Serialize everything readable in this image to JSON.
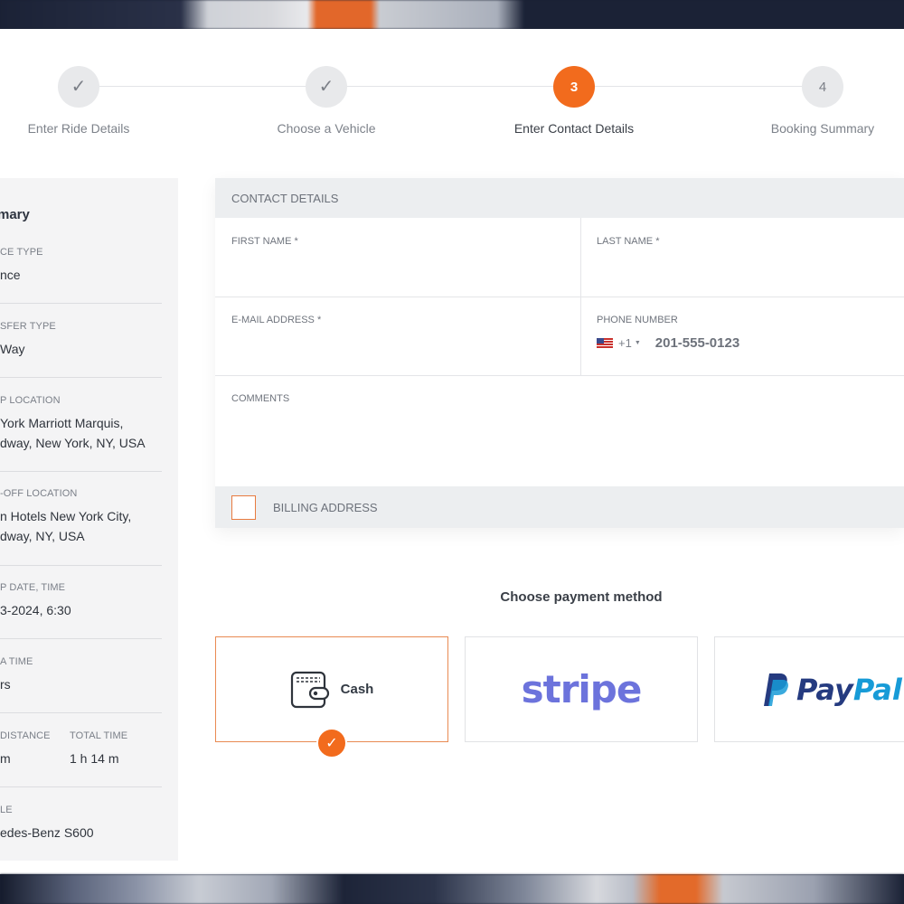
{
  "stepper": {
    "steps": [
      {
        "label": "Enter Ride Details",
        "marker": "✓",
        "state": "done"
      },
      {
        "label": "Choose a Vehicle",
        "marker": "✓",
        "state": "done"
      },
      {
        "label": "Enter Contact Details",
        "marker": "3",
        "state": "active"
      },
      {
        "label": "Booking Summary",
        "marker": "4",
        "state": "pending"
      }
    ]
  },
  "summary": {
    "title": "mary",
    "items": [
      {
        "label": "CE TYPE",
        "value": "nce"
      },
      {
        "label": "SFER TYPE",
        "value": "Way"
      },
      {
        "label": "P LOCATION",
        "value_line1": "York Marriott Marquis,",
        "value_line2": "dway, New York, NY, USA"
      },
      {
        "label": "-OFF LOCATION",
        "value_line1": "n Hotels New York City,",
        "value_line2": "dway, NY, USA"
      },
      {
        "label": "P DATE, TIME",
        "value": "3-2024, 6:30"
      },
      {
        "label": "A TIME",
        "value": "rs"
      },
      {
        "label_a": "DISTANCE",
        "value_a": "m",
        "label_b": "TOTAL TIME",
        "value_b": "1 h 14 m"
      },
      {
        "label": "LE",
        "value": "edes-Benz S600"
      }
    ]
  },
  "contact": {
    "header": "CONTACT DETAILS",
    "first_name_label": "FIRST NAME",
    "last_name_label": "LAST NAME",
    "email_label": "E-MAIL ADDRESS",
    "phone_label": "PHONE NUMBER",
    "required_mark": "*",
    "phone_dial_code": "+1",
    "phone_placeholder": "201-555-0123",
    "comments_label": "COMMENTS",
    "billing_label": "BILLING ADDRESS"
  },
  "payment": {
    "title": "Choose payment method",
    "methods": [
      {
        "id": "cash",
        "label": "Cash",
        "icon": "wallet-icon",
        "selected": true
      },
      {
        "id": "stripe",
        "label": "stripe",
        "icon": "stripe-logo",
        "selected": false
      },
      {
        "id": "paypal",
        "label_pay": "Pay",
        "label_pal": "Pal",
        "icon": "paypal-logo",
        "selected": false
      }
    ],
    "selected_marker": "✓"
  },
  "colors": {
    "accent": "#f26b1d",
    "stripe": "#6c73dc",
    "paypal_dark": "#253b80",
    "paypal_light": "#179bd7"
  }
}
